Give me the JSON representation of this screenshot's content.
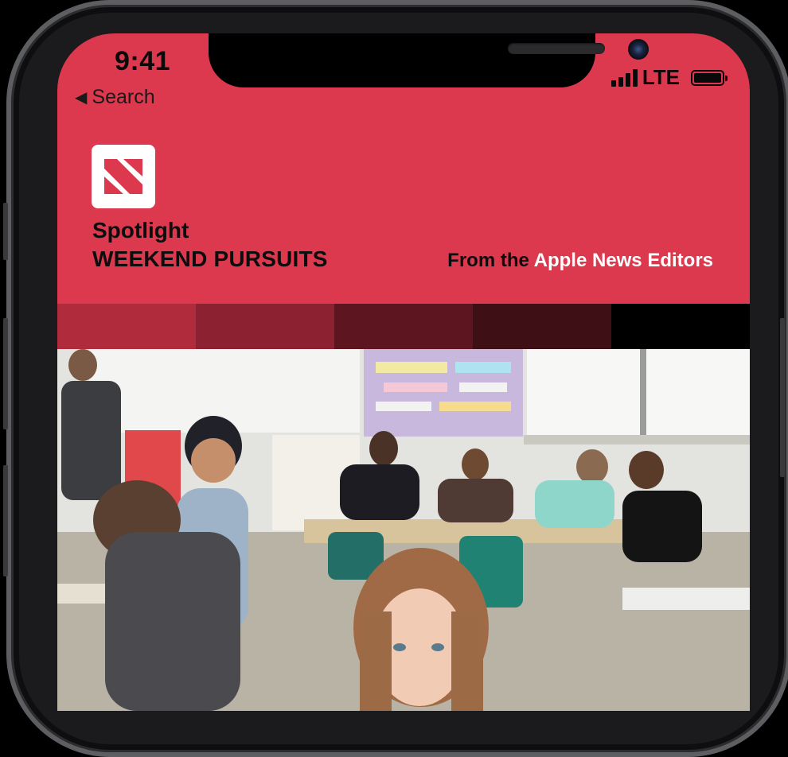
{
  "status_bar": {
    "time": "9:41",
    "network": "LTE",
    "battery_level": 1.0,
    "back_label": "Search"
  },
  "header": {
    "brand_icon": "apple-news-icon",
    "spotlight_label": "Spotlight",
    "section_title": "WEEKEND PURSUITS",
    "byline_prefix": "From the",
    "byline_source": "Apple News Editors",
    "background_color": "#dc394f"
  },
  "color_strip": [
    "#b02c3d",
    "#8c2231",
    "#5d1620",
    "#3f0f16",
    "#000000"
  ],
  "hero_image": {
    "description_icon": "classroom-photo"
  }
}
